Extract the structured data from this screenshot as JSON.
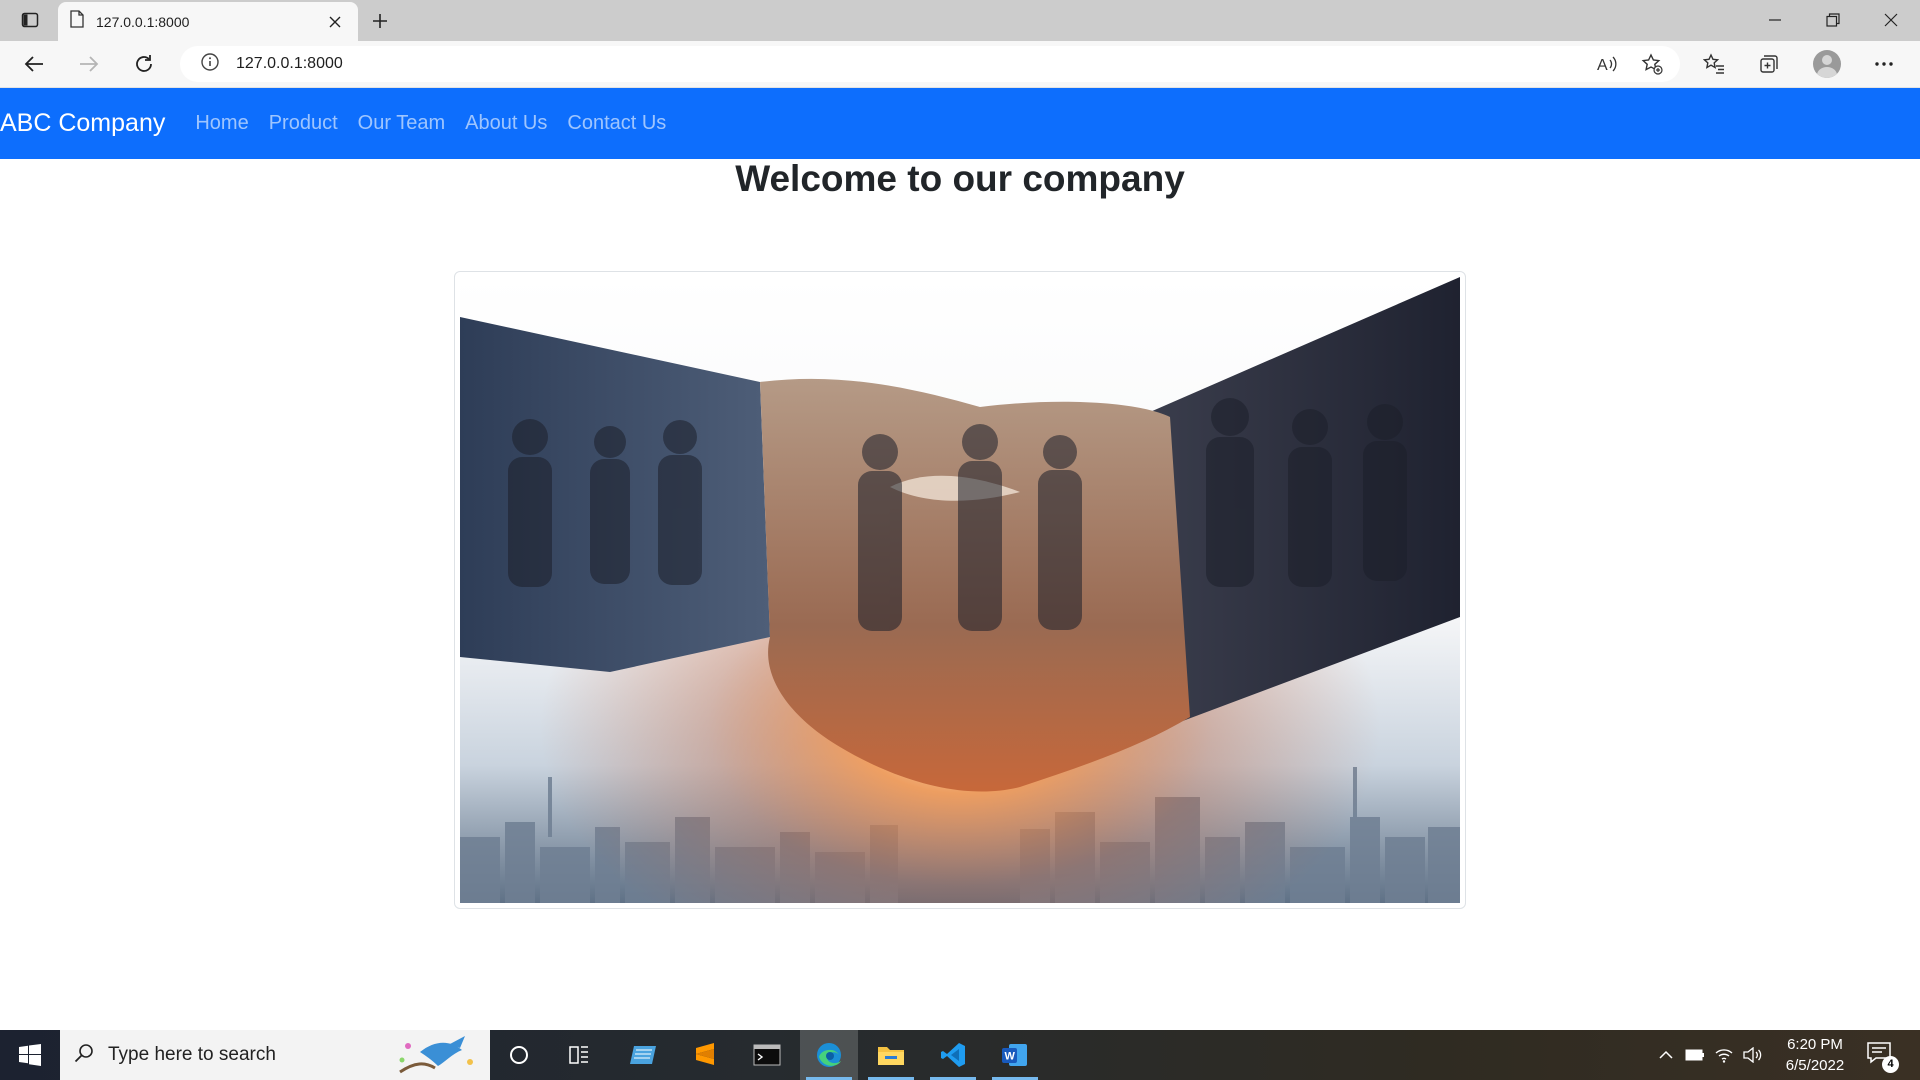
{
  "browser": {
    "tab_title": "127.0.0.1:8000",
    "url": "127.0.0.1:8000"
  },
  "site": {
    "brand": "ABC Company",
    "nav": [
      "Home",
      "Product",
      "Our Team",
      "About Us",
      "Contact Us"
    ],
    "heading": "Welcome to our company",
    "colors": {
      "navbar": "#0d6efd",
      "nav_link": "rgba(255,255,255,0.6)",
      "heading": "#212529"
    }
  },
  "taskbar": {
    "search_placeholder": "Type here to search",
    "time": "6:20 PM",
    "date": "6/5/2022",
    "notification_count": "4",
    "apps": [
      "cortana-icon",
      "task-view-icon",
      "app-icon",
      "sublime-text-icon",
      "terminal-icon",
      "edge-icon",
      "file-explorer-icon",
      "vscode-icon",
      "word-icon"
    ]
  }
}
